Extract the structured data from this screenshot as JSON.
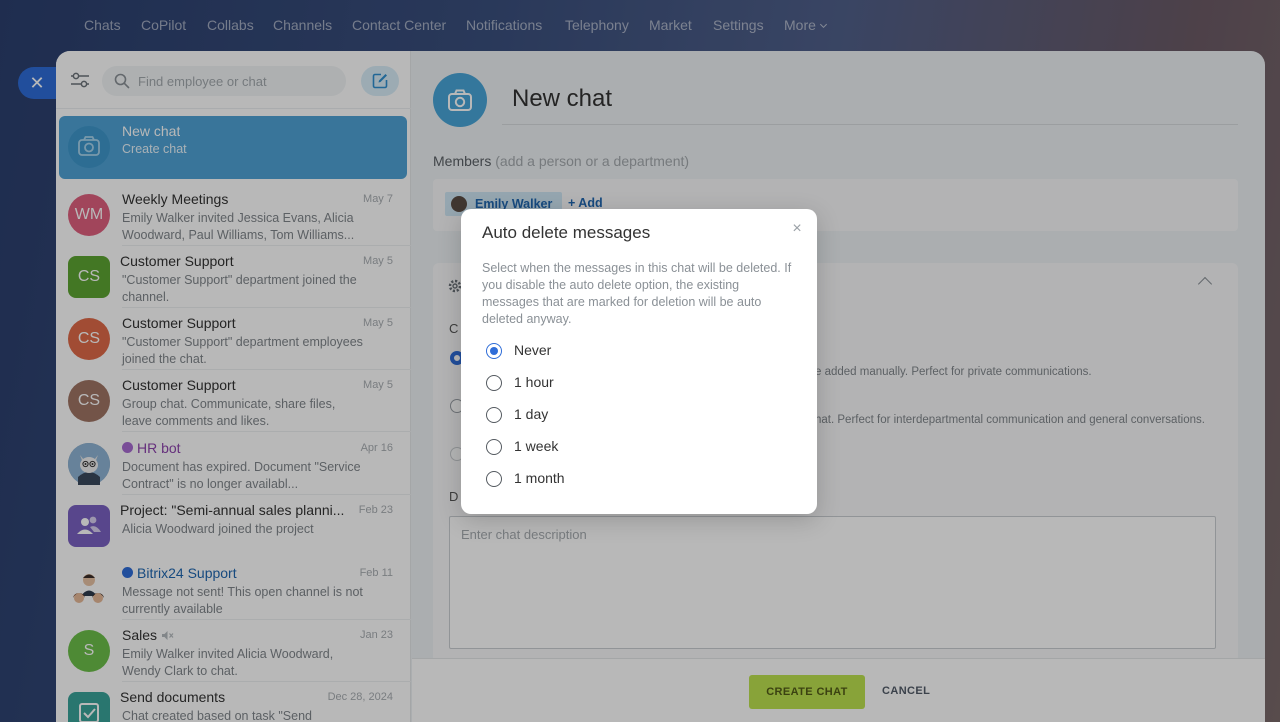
{
  "nav": {
    "items": [
      "Chats",
      "CoPilot",
      "Collabs",
      "Channels",
      "Contact Center",
      "Notifications",
      "Telephony",
      "Market",
      "Settings",
      "More"
    ]
  },
  "search": {
    "placeholder": "Find employee or chat"
  },
  "sidebar": {
    "chats": [
      {
        "title": "New chat",
        "preview": "Create chat",
        "date": "",
        "avatar_text": "",
        "avatar_color": "#3f98cc",
        "active": true
      },
      {
        "title": "Weekly Meetings",
        "preview": "Emily Walker invited Jessica Evans, Alicia Woodward, Paul Williams, Tom Williams...",
        "date": "May 7",
        "avatar_text": "WM",
        "avatar_color": "#e0607e"
      },
      {
        "title": "Customer Support",
        "preview": "\"Customer Support\" department joined the channel.",
        "date": "May 5",
        "avatar_text": "CS",
        "avatar_color": "#5ea532"
      },
      {
        "title": "Customer Support",
        "preview": "\"Customer Support\" department employees joined the chat.",
        "date": "May 5",
        "avatar_text": "CS",
        "avatar_color": "#df6a48"
      },
      {
        "title": "Customer Support",
        "preview": "Group chat. Communicate, share files, leave comments and likes.",
        "date": "May 5",
        "avatar_text": "CS",
        "avatar_color": "#a07565"
      },
      {
        "title": "HR bot",
        "preview": "Document has expired. Document \"Service Contract\" is no longer availabl...",
        "date": "Apr 16",
        "avatar_text": "",
        "avatar_color": "#6f8aa3",
        "title_color": "#8e44ad"
      },
      {
        "title": "Project: \"Semi-annual sales planni...",
        "preview": "Alicia Woodward joined the project",
        "date": "Feb 23",
        "avatar_text": "",
        "avatar_color": "#7b61c2"
      },
      {
        "title": "Bitrix24 Support",
        "preview": "Message not sent! This open channel is not currently available",
        "date": "Feb 11",
        "avatar_text": "",
        "avatar_color": "#f3f3f3",
        "title_color": "#2067b0"
      },
      {
        "title": "Sales",
        "preview": "Emily Walker invited Alicia Woodward, Wendy Clark to chat.",
        "date": "Jan 23",
        "avatar_text": "S",
        "avatar_color": "#6cbf4a"
      },
      {
        "title": "Send documents",
        "preview": "Chat created based on task \"Send",
        "date": "Dec 28, 2024",
        "avatar_text": "",
        "avatar_color": "#3aa49a"
      }
    ]
  },
  "main": {
    "chat_name": "New chat",
    "members_label": "Members",
    "members_hint": "(add a person or a department)",
    "member_name": "Emily Walker",
    "add_label": "+ Add",
    "description_placeholder": "Enter chat description",
    "type_option_1_desc": "e added manually. Perfect for private communications.",
    "type_option_2_desc": "hat. Perfect for interdepartmental communication and general conversations.",
    "section_letter_1": "C",
    "section_letter_2": "D"
  },
  "footer": {
    "create_label": "CREATE CHAT",
    "cancel_label": "CANCEL"
  },
  "modal": {
    "title": "Auto delete messages",
    "description": "Select when the messages in this chat will be deleted. If you disable the auto delete option, the existing messages that are marked for deletion will be auto deleted anyway.",
    "options": [
      {
        "label": "Never",
        "checked": true
      },
      {
        "label": "1 hour",
        "checked": false
      },
      {
        "label": "1 day",
        "checked": false
      },
      {
        "label": "1 week",
        "checked": false
      },
      {
        "label": "1 month",
        "checked": false
      }
    ]
  }
}
